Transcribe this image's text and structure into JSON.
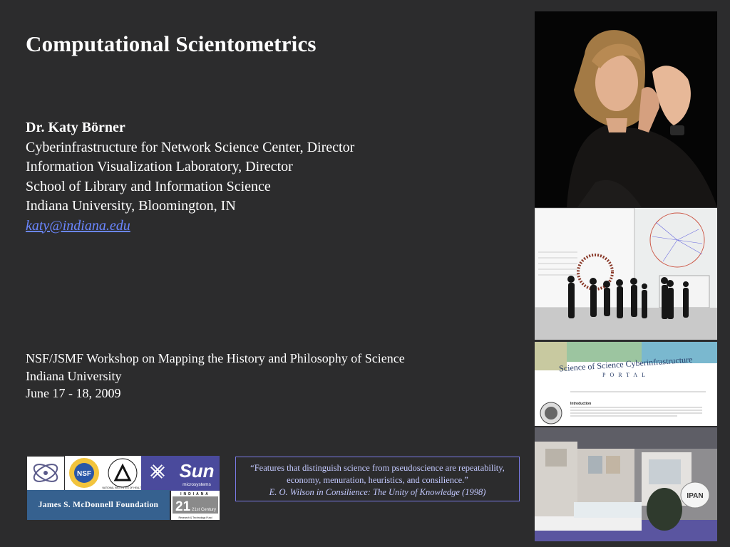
{
  "slide": {
    "title": "Computational Scientometrics",
    "author": {
      "name": "Dr. Katy Börner",
      "lines": [
        "Cyberinfrastructure for Network Science Center, Director",
        "Information Visualization Laboratory, Director",
        "School of Library and Information Science",
        "Indiana University, Bloomington, IN"
      ],
      "email": "katy@indiana.edu"
    },
    "workshop": {
      "lines": [
        "NSF/JSMF Workshop on Mapping the History and Philosophy of Science",
        "Indiana University",
        "June 17 - 18, 2009"
      ]
    },
    "quote": {
      "text": "“Features that distinguish science from pseudoscience are repeatability, economy, menuration, heuristics, and consilience.”",
      "cite": "E. O. Wilson in Consilience: The Unity of Knowledge (1998)"
    },
    "logos": {
      "nsf": "NSF",
      "nih": "NATIONAL INSTITUTES OF HEALTH",
      "sun": "Sun",
      "sun_sub": "microsystems",
      "mcdonnell": "James S. McDonnell Foundation",
      "indiana21": "INDIANA",
      "indiana21_sub": "21st Century",
      "indiana21_sub2": "Research & Technology Fund"
    },
    "portal": {
      "title": "Science of Science Cyberinfrastructure",
      "subtitle": "PORTAL",
      "intro_heading": "Introduction"
    },
    "expo_sign": "IPAN"
  }
}
